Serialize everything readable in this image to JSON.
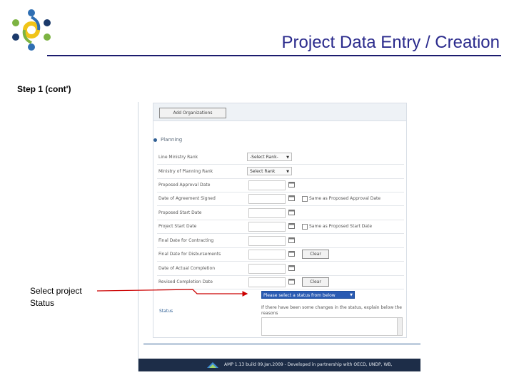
{
  "slide": {
    "title": "Project Data Entry / Creation",
    "step": "Step 1 (cont')",
    "callout": [
      "Select project",
      "Status"
    ]
  },
  "form": {
    "add_org_button": "Add Organizations",
    "planning_heading": "Planning",
    "rows": [
      {
        "label": "Line Ministry Rank",
        "control": "select",
        "value": "-Select Rank-"
      },
      {
        "label": "Ministry of Planning Rank",
        "control": "select",
        "value": "Select Rank"
      },
      {
        "label": "Proposed Approval Date",
        "control": "date"
      },
      {
        "label": "Date of Agreement Signed",
        "control": "date",
        "checkbox": "Same as Proposed Approval Date"
      },
      {
        "label": "Proposed Start Date",
        "control": "date"
      },
      {
        "label": "Project Start Date",
        "control": "date",
        "checkbox": "Same as Proposed Start Date"
      },
      {
        "label": "Final Date for Contracting",
        "control": "date"
      },
      {
        "label": "Final Date for Disbursements",
        "control": "date",
        "button": "Clear"
      },
      {
        "label": "Date of Actual Completion",
        "control": "date"
      },
      {
        "label": "Revised Completion Date",
        "control": "date",
        "button": "Clear"
      }
    ],
    "status": {
      "label": "Status",
      "select_value": "Please select a status from below",
      "note": "If there have been some changes in the status, explain below the reasons"
    },
    "footer": "AMP 1.13 build 09.Jan.2009 - Developed in partnership with OECD, UNDP, WB,"
  },
  "colors": {
    "title": "#2a2a8c",
    "rule": "#1b1b6e",
    "arrow": "#cc0000",
    "status_highlight": "#2a5bb3",
    "footer_bg": "#1d2d48"
  }
}
